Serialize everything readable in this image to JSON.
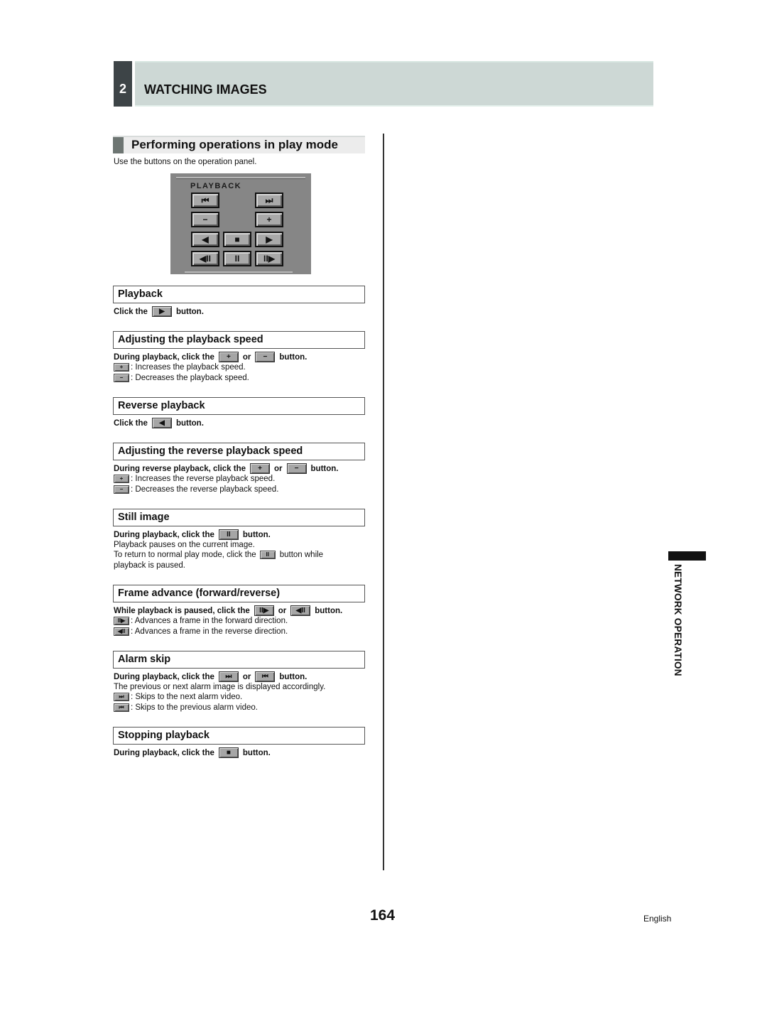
{
  "chapter": {
    "number": "2",
    "title": "WATCHING IMAGES"
  },
  "section": {
    "title": "Performing operations in play mode",
    "intro": "Use the buttons on the operation panel."
  },
  "panel": {
    "label": "PLAYBACK",
    "buttons": {
      "prev_alarm": "⏮",
      "next_alarm": "⏭",
      "minus": "−",
      "plus": "+",
      "reverse": "◀",
      "stop": "■",
      "play": "▶",
      "frame_rev": "◀II",
      "pause": "II",
      "frame_fwd": "II▶"
    }
  },
  "subsections": [
    {
      "title": "Playback",
      "lines": [
        {
          "pre": "Click the",
          "btn1": "▶",
          "post": "button."
        }
      ]
    },
    {
      "title": "Adjusting the playback speed",
      "lines": [
        {
          "pre": "During playback, click the",
          "btn1": "+",
          "mid": "or",
          "btn2": "−",
          "post": "button."
        }
      ],
      "notes": [
        {
          "icon": "+",
          "text": ": Increases the playback speed."
        },
        {
          "icon": "−",
          "text": ": Decreases the playback speed."
        }
      ]
    },
    {
      "title": "Reverse playback",
      "lines": [
        {
          "pre": "Click the",
          "btn1": "◀",
          "post": "button."
        }
      ]
    },
    {
      "title": "Adjusting the reverse playback speed",
      "lines": [
        {
          "pre": "During reverse playback, click the",
          "btn1": "+",
          "mid": "or",
          "btn2": "−",
          "post": "button."
        }
      ],
      "notes": [
        {
          "icon": "+",
          "text": ": Increases the reverse playback speed."
        },
        {
          "icon": "−",
          "text": ": Decreases the reverse playback speed."
        }
      ]
    },
    {
      "title": "Still image",
      "lines": [
        {
          "pre": "During playback, click the",
          "btn1": "II",
          "post": "button."
        }
      ],
      "body": [
        "Playback pauses on the current image."
      ],
      "body2": {
        "pre": "To return to normal play mode, click the",
        "icon": "II",
        "post": "button while",
        "cont": "playback is paused."
      }
    },
    {
      "title": "Frame advance (forward/reverse)",
      "lines": [
        {
          "pre": "While playback is paused, click the",
          "btn1": "II▶",
          "mid": "or",
          "btn2": "◀II",
          "post": "button."
        }
      ],
      "notes": [
        {
          "icon": "II▶",
          "text": ": Advances a frame in the forward direction."
        },
        {
          "icon": "◀II",
          "text": ": Advances a frame in the reverse direction."
        }
      ]
    },
    {
      "title": "Alarm skip",
      "lines": [
        {
          "pre": "During playback, click the",
          "btn1": "⏭",
          "mid": "or",
          "btn2": "⏮",
          "post": "button."
        }
      ],
      "body": [
        "The previous or next alarm image is displayed accordingly."
      ],
      "notes": [
        {
          "icon": "⏭",
          "text": ": Skips to the next alarm video."
        },
        {
          "icon": "⏮",
          "text": ": Skips to the previous alarm video."
        }
      ]
    },
    {
      "title": "Stopping playback",
      "lines": [
        {
          "pre": "During playback, click the",
          "btn1": "■",
          "post": "button."
        }
      ]
    }
  ],
  "side_tab": {
    "text": "NETWORK OPERATION"
  },
  "footer": {
    "page_number": "164",
    "language": "English"
  }
}
